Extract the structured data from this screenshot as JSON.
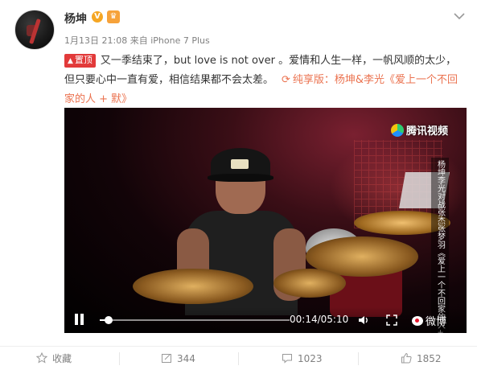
{
  "post": {
    "username": "杨坤",
    "verified_badge": "V",
    "member_icon": "crown-icon",
    "timestamp": "1月13日 21:08",
    "source_prefix": "来自",
    "source": "iPhone 7 Plus",
    "pinned_label": "置顶",
    "body_text": "又一季结束了，but love is not over 。爱情和人生一样，一帆风顺的太少，但只要心中一直有爱，相信结果都不会太差。",
    "video_link": "纯享版：杨坤&李光《爱上一个不回家的人 + 默》"
  },
  "video": {
    "watermark": "腾讯视频",
    "caption": "杨坤李光对战张杰张梦羽《爱上一个不回家的人+默》",
    "time_display": "00:14/05:10",
    "progress": 0.045,
    "brand": "微博"
  },
  "actions": {
    "favorite_label": "收藏",
    "repost_count": "344",
    "comment_count": "1023",
    "like_count": "1852"
  },
  "colors": {
    "accent": "#eb7350",
    "pinned_bg": "#e23a3a",
    "meta_text": "#808080"
  }
}
